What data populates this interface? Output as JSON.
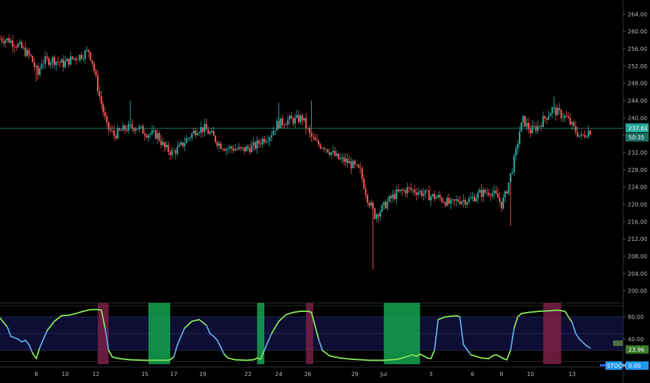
{
  "colors": {
    "background": "#000000",
    "candle_up": "#26a69a",
    "candle_down": "#ef5350",
    "price_line": "#26a69a",
    "stoch_line_upper": "#7ed957",
    "stoch_line_lower": "#5aa0d8",
    "band_fill": "#1a1a5e",
    "overbought_zone": "#7a1f45",
    "oversold_zone": "#14a350"
  },
  "chart_data": [
    {
      "type": "candlestick",
      "title": "",
      "x_tick_labels": [
        "8",
        "10",
        "12",
        "15",
        "17",
        "19",
        "22",
        "24",
        "26",
        "29",
        "Jul",
        "3",
        "6",
        "8",
        "10",
        "13"
      ],
      "y_tick_labels": [
        "264.00",
        "260.00",
        "256.00",
        "252.00",
        "248.00",
        "244.00",
        "240.00",
        "236.00",
        "232.00",
        "228.00",
        "224.00",
        "220.00",
        "216.00",
        "212.00",
        "208.00",
        "204.00",
        "200.00"
      ],
      "ylim": [
        198,
        266
      ],
      "last_price": "237.61",
      "countdown": "50:35",
      "price_path": [
        [
          0,
          258.5
        ],
        [
          3,
          258
        ],
        [
          6,
          256.5
        ],
        [
          9,
          254
        ],
        [
          11,
          250
        ],
        [
          12,
          253
        ],
        [
          15,
          253.5
        ],
        [
          18,
          252.5
        ],
        [
          20,
          253.5
        ],
        [
          23,
          254.5
        ],
        [
          25,
          255.5
        ],
        [
          26,
          253
        ],
        [
          28,
          245
        ],
        [
          30,
          238
        ],
        [
          32,
          236
        ],
        [
          35,
          237.5
        ],
        [
          38,
          238
        ],
        [
          41,
          236.5
        ],
        [
          44,
          236
        ],
        [
          46,
          233
        ],
        [
          48,
          232
        ],
        [
          50,
          233
        ],
        [
          52,
          235
        ],
        [
          55,
          237.5
        ],
        [
          57,
          237.5
        ],
        [
          59,
          236
        ],
        [
          61,
          234
        ],
        [
          63,
          233
        ],
        [
          65,
          233
        ],
        [
          67,
          232.5
        ],
        [
          69,
          233
        ],
        [
          71,
          233.5
        ],
        [
          73,
          235
        ],
        [
          75,
          236
        ],
        [
          77,
          238.5
        ],
        [
          80,
          239.5
        ],
        [
          82,
          239.5
        ],
        [
          84,
          240
        ],
        [
          86,
          236
        ],
        [
          88,
          234
        ],
        [
          90,
          233.5
        ],
        [
          92,
          232
        ],
        [
          94,
          230.5
        ],
        [
          96,
          230
        ],
        [
          98,
          229
        ],
        [
          100,
          227.5
        ],
        [
          102,
          221.5
        ],
        [
          104,
          217.5
        ],
        [
          106,
          219
        ],
        [
          108,
          221
        ],
        [
          110,
          222.5
        ],
        [
          113,
          223.5
        ],
        [
          116,
          223
        ],
        [
          119,
          222
        ],
        [
          122,
          221.5
        ],
        [
          125,
          220
        ],
        [
          127,
          221
        ],
        [
          130,
          221
        ],
        [
          133,
          222.5
        ],
        [
          136,
          223
        ],
        [
          138,
          221.5
        ],
        [
          139,
          220
        ],
        [
          140,
          222
        ],
        [
          141,
          225
        ],
        [
          143,
          232
        ],
        [
          144,
          237
        ],
        [
          145,
          239.5
        ],
        [
          147,
          237
        ],
        [
          149,
          238
        ],
        [
          151,
          240
        ],
        [
          153,
          242
        ],
        [
          155,
          241
        ],
        [
          157,
          240
        ],
        [
          159,
          237.5
        ],
        [
          161,
          235.5
        ],
        [
          163,
          237
        ]
      ],
      "spikes": [
        [
          10,
          248.5
        ],
        [
          36,
          244
        ],
        [
          77,
          243.5
        ],
        [
          86,
          244
        ],
        [
          103,
          205
        ],
        [
          141,
          215
        ],
        [
          153,
          245
        ]
      ]
    },
    {
      "type": "line",
      "title": "",
      "indicator_label": "STOCH",
      "values_label": "23.96",
      "zero_label": "0.00",
      "y_tick_labels": [
        "80.00",
        "40.00"
      ],
      "ylim": [
        -5,
        105
      ],
      "stoch": [
        [
          0,
          78
        ],
        [
          2,
          62
        ],
        [
          3,
          45
        ],
        [
          5,
          40
        ],
        [
          6,
          35
        ],
        [
          7,
          38
        ],
        [
          8,
          30
        ],
        [
          9,
          15
        ],
        [
          10,
          5
        ],
        [
          11,
          25
        ],
        [
          13,
          55
        ],
        [
          15,
          72
        ],
        [
          17,
          82
        ],
        [
          19,
          83
        ],
        [
          21,
          86
        ],
        [
          23,
          90
        ],
        [
          25,
          93
        ],
        [
          27,
          93
        ],
        [
          28,
          92
        ],
        [
          29,
          60
        ],
        [
          30,
          20
        ],
        [
          31,
          8
        ],
        [
          33,
          5
        ],
        [
          36,
          3
        ],
        [
          40,
          2
        ],
        [
          43,
          2
        ],
        [
          46,
          2
        ],
        [
          47,
          3
        ],
        [
          48,
          8
        ],
        [
          49,
          30
        ],
        [
          51,
          60
        ],
        [
          53,
          72
        ],
        [
          55,
          75
        ],
        [
          57,
          65
        ],
        [
          58,
          50
        ],
        [
          59,
          45
        ],
        [
          60,
          38
        ],
        [
          61,
          25
        ],
        [
          62,
          12
        ],
        [
          63,
          6
        ],
        [
          65,
          3
        ],
        [
          68,
          2
        ],
        [
          70,
          3
        ],
        [
          71,
          6
        ],
        [
          72,
          4
        ],
        [
          73,
          20
        ],
        [
          75,
          50
        ],
        [
          77,
          72
        ],
        [
          79,
          84
        ],
        [
          81,
          88
        ],
        [
          83,
          90
        ],
        [
          85,
          90
        ],
        [
          86,
          88
        ],
        [
          88,
          40
        ],
        [
          89,
          20
        ],
        [
          91,
          10
        ],
        [
          94,
          6
        ],
        [
          97,
          4
        ],
        [
          100,
          3
        ],
        [
          102,
          2
        ],
        [
          104,
          2
        ],
        [
          106,
          2
        ],
        [
          108,
          3
        ],
        [
          110,
          4
        ],
        [
          112,
          8
        ],
        [
          114,
          12
        ],
        [
          115,
          9
        ],
        [
          116,
          13
        ],
        [
          117,
          10
        ],
        [
          118,
          6
        ],
        [
          119,
          5
        ],
        [
          120,
          20
        ],
        [
          121,
          75
        ],
        [
          123,
          80
        ],
        [
          126,
          82
        ],
        [
          127,
          80
        ],
        [
          128,
          30
        ],
        [
          130,
          12
        ],
        [
          133,
          6
        ],
        [
          135,
          5
        ],
        [
          136,
          10
        ],
        [
          137,
          12
        ],
        [
          138,
          9
        ],
        [
          139,
          5
        ],
        [
          140,
          3
        ],
        [
          141,
          20
        ],
        [
          142,
          60
        ],
        [
          143,
          80
        ],
        [
          144,
          86
        ],
        [
          146,
          88
        ],
        [
          149,
          90
        ],
        [
          152,
          91
        ],
        [
          154,
          92
        ],
        [
          156,
          90
        ],
        [
          158,
          70
        ],
        [
          159,
          50
        ],
        [
          160,
          40
        ],
        [
          162,
          28
        ],
        [
          163,
          24
        ]
      ],
      "overbought_zones": [
        [
          27,
          30
        ],
        [
          84.5,
          86.5
        ],
        [
          150,
          155
        ]
      ],
      "oversold_zones": [
        [
          41,
          47
        ],
        [
          71,
          73
        ],
        [
          106,
          116
        ]
      ]
    }
  ],
  "x_tick_positions": [
    10,
    18,
    26.5,
    40,
    48,
    56,
    68.5,
    77,
    85,
    98,
    106,
    119,
    130.5,
    138.5,
    146.5,
    158
  ]
}
